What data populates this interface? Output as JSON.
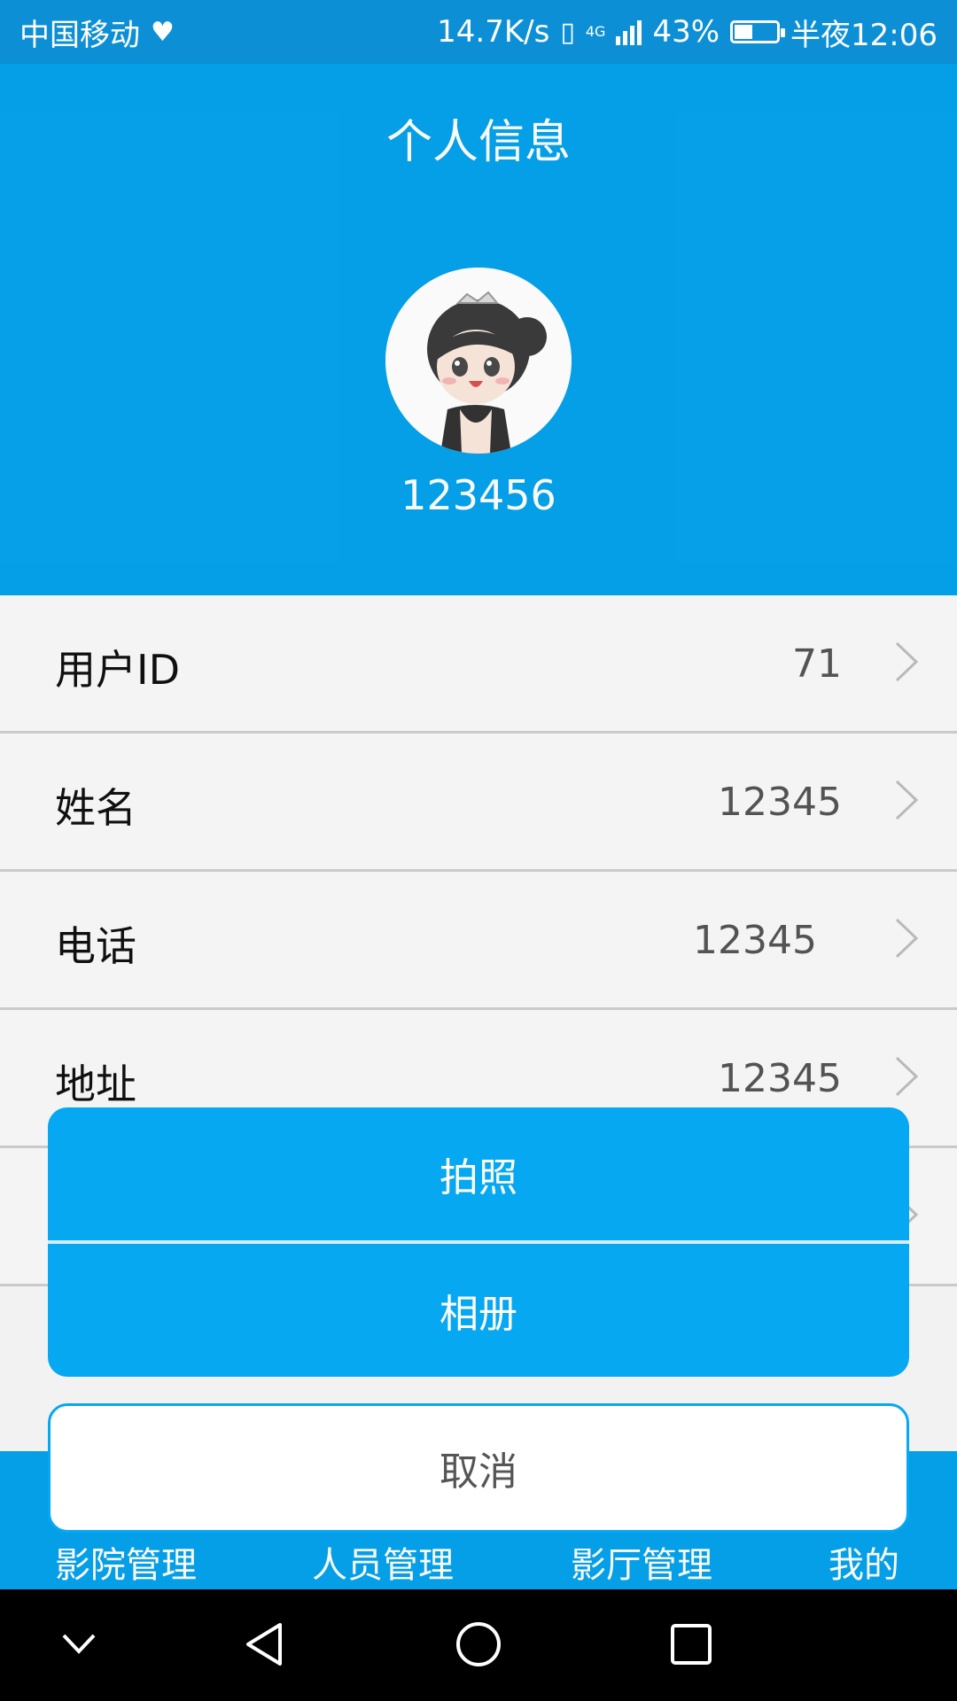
{
  "status_bar": {
    "carrier": "中国移动",
    "net_speed": "14.7K/s",
    "network": "4G",
    "battery": "43%",
    "time": "半夜12:06"
  },
  "header": {
    "title": "个人信息",
    "username": "123456"
  },
  "list": {
    "rows": [
      {
        "label": "用户ID",
        "value": "71"
      },
      {
        "label": "姓名",
        "value": "12345"
      },
      {
        "label": "电话",
        "value": "12345"
      },
      {
        "label": "地址",
        "value": "12345"
      },
      {
        "label": "",
        "value": ""
      }
    ]
  },
  "bottom_nav": {
    "items": [
      "影院管理",
      "人员管理",
      "影厅管理",
      "我的"
    ]
  },
  "action_sheet": {
    "take_photo": "拍照",
    "album": "相册",
    "cancel": "取消"
  },
  "colors": {
    "primary": "#05a3ec",
    "sheet": "#06a8f1",
    "status_bar": "#0d8fd6"
  }
}
